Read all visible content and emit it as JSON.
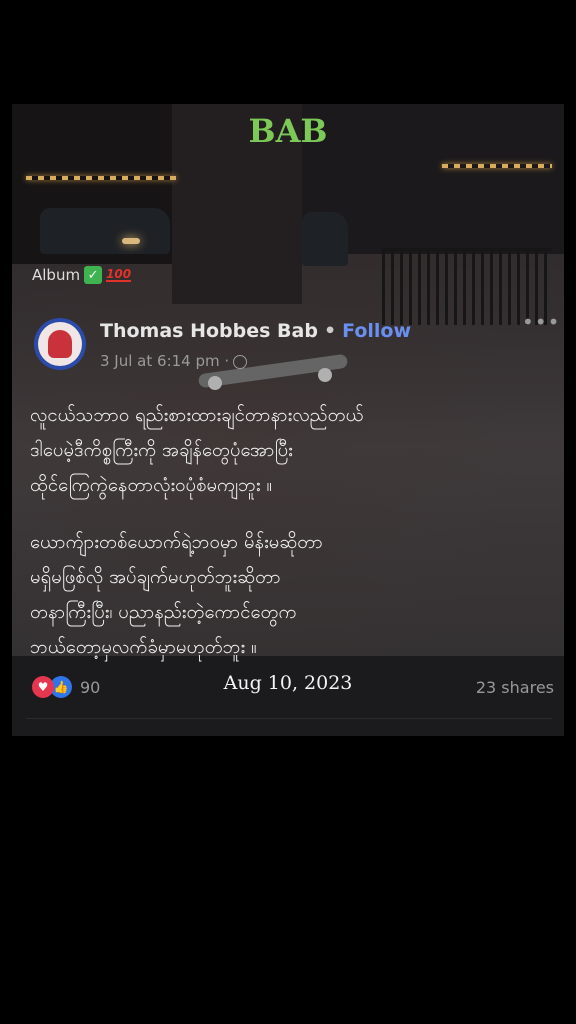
{
  "header": {
    "watermark": "BAB"
  },
  "album": {
    "label": "Album",
    "check_icon": "check-icon",
    "hundred_label": "100"
  },
  "author": {
    "name": "Thomas Hobbes Bab",
    "separator": "•",
    "follow_label": "Follow",
    "timestamp": "3 Jul at 6:14 pm ·"
  },
  "post": {
    "paragraph1": "လူငယ်သဘာဝ ရည်းစားထားချင်တာနားလည်တယ်\nဒါပေမဲ့ဒီကိစ္စကြီးကို အချိန်တွေပုံအောပြီး\nထိုင်ကြေကွဲနေတာလုံးဝပုံစံမကျဘူး ။",
    "paragraph2": "ယောက်ျားတစ်ယောက်ရဲ့ဘဝမှာ မိန်းမဆိုတာ\nမရှိမဖြစ်လို အပ်ချက်မဟုတ်ဘူးဆိုတာ\nတနာကြီးပြီး၊ ပညာနည်းတဲ့ကောင်တွေက\nဘယ်တော့မှလက်ခံမှာမဟုတ်ဘူး ။"
  },
  "stats": {
    "reactions_count": "90",
    "date": "Aug 10, 2023",
    "shares": "23 shares"
  },
  "colors": {
    "accent_green": "#7cc957",
    "follow_blue": "#6a8ff0",
    "heart_red": "#e5364f",
    "like_blue": "#2f74e8"
  }
}
